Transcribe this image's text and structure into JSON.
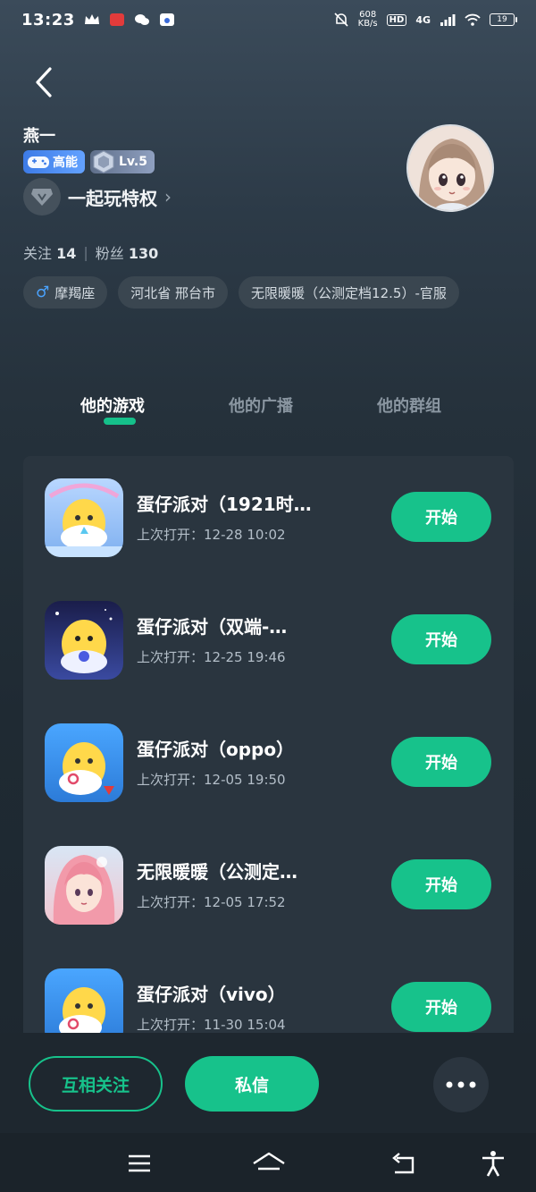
{
  "status_bar": {
    "time": "13:23",
    "net_speed_top": "608",
    "net_speed_bottom": "KB/s",
    "hd": "HD",
    "signal": "4G",
    "battery": "19"
  },
  "profile": {
    "username": "燕一",
    "badge_gamer": "高能",
    "badge_level": "Lv.5",
    "privilege_label": "一起玩特权",
    "stats": {
      "following_label": "关注",
      "following_count": "14",
      "fans_label": "粉丝",
      "fans_count": "130"
    },
    "tags": [
      "摩羯座",
      "河北省 邢台市",
      "无限暖暖（公测定档12.5）-官服"
    ]
  },
  "tabs": [
    {
      "label": "他的游戏",
      "active": true
    },
    {
      "label": "他的广播",
      "active": false
    },
    {
      "label": "他的群组",
      "active": false
    }
  ],
  "games": [
    {
      "title": "蛋仔派对（1921时…",
      "last_opened": "上次打开：12-28 10:02",
      "button": "开始",
      "icon": "eggy-party-icon-1"
    },
    {
      "title": "蛋仔派对（双端-…",
      "last_opened": "上次打开：12-25 19:46",
      "button": "开始",
      "icon": "eggy-party-icon-2"
    },
    {
      "title": "蛋仔派对（oppo）",
      "last_opened": "上次打开：12-05 19:50",
      "button": "开始",
      "icon": "eggy-party-icon-3"
    },
    {
      "title": "无限暖暖（公测定…",
      "last_opened": "上次打开：12-05 17:52",
      "button": "开始",
      "icon": "infinity-nikki-icon"
    },
    {
      "title": "蛋仔派对（vivo）",
      "last_opened": "上次打开：11-30 15:04",
      "button": "开始",
      "icon": "eggy-party-icon-4"
    }
  ],
  "actions": {
    "mutual_follow": "互相关注",
    "direct_message": "私信"
  },
  "colors": {
    "accent": "#17c28b",
    "background": "#1f2a33",
    "card": "#2a353f"
  }
}
